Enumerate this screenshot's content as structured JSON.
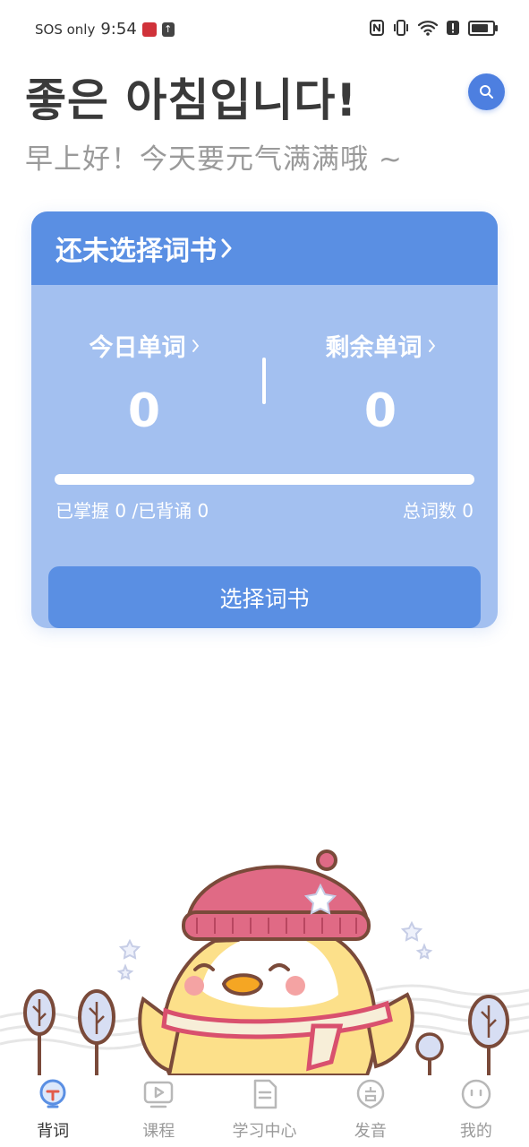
{
  "status_bar": {
    "carrier": "SOS only",
    "time": "9:54"
  },
  "header": {
    "greeting_korean": "좋은 아침입니다!",
    "greeting_chinese": "早上好！今天要元气满满哦 ~",
    "search_icon": "search-icon"
  },
  "card": {
    "title": "还未选择词书",
    "today_words_label": "今日单词",
    "today_words_value": "0",
    "remaining_words_label": "剩余单词",
    "remaining_words_value": "0",
    "progress_fraction": 0,
    "mastered_text": "已掌握 0 /已背诵 0",
    "total_words_text": "总词数 0",
    "select_button": "选择词书"
  },
  "bottom_nav": {
    "items": [
      {
        "label": "背词",
        "icon": "bulb-icon",
        "active": true
      },
      {
        "label": "课程",
        "icon": "video-icon",
        "active": false
      },
      {
        "label": "学习中心",
        "icon": "document-icon",
        "active": false
      },
      {
        "label": "发音",
        "icon": "voice-icon",
        "active": false
      },
      {
        "label": "我的",
        "icon": "profile-icon",
        "active": false
      }
    ]
  },
  "colors": {
    "accent": "#5a8fe3",
    "card_body": "#a3c0f0",
    "search_button": "#4d7fe0"
  }
}
